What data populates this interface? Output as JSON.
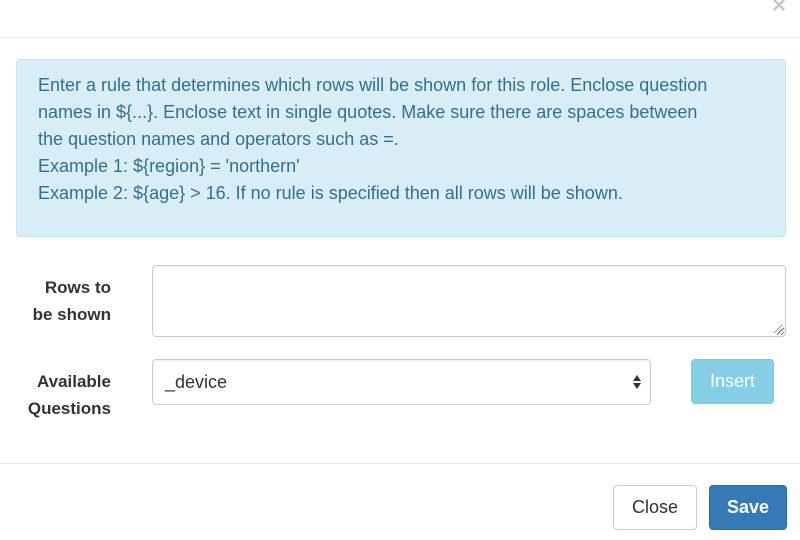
{
  "header": {
    "close_glyph": "×"
  },
  "info": {
    "lines": [
      "Enter a rule that determines which rows will be shown for this role. Enclose question",
      "names in ${...}. Enclose text in single quotes. Make sure there are spaces between",
      "the question names and operators such as =.",
      "Example 1: ${region} = 'northern'",
      "Example 2: ${age} > 16. If no rule is specified then all rows will be shown."
    ]
  },
  "form": {
    "rows_label_line1": "Rows to",
    "rows_label_line2": "be shown",
    "rows_value": "",
    "questions_label_line1": "Available",
    "questions_label_line2": "Questions",
    "questions_selected": "_device",
    "insert_label": "Insert"
  },
  "footer": {
    "close_label": "Close",
    "save_label": "Save"
  },
  "colors": {
    "info_bg": "#d9edf7",
    "info_text": "#31708f",
    "insert_bg": "#5bc0de",
    "save_bg": "#337ab7"
  }
}
